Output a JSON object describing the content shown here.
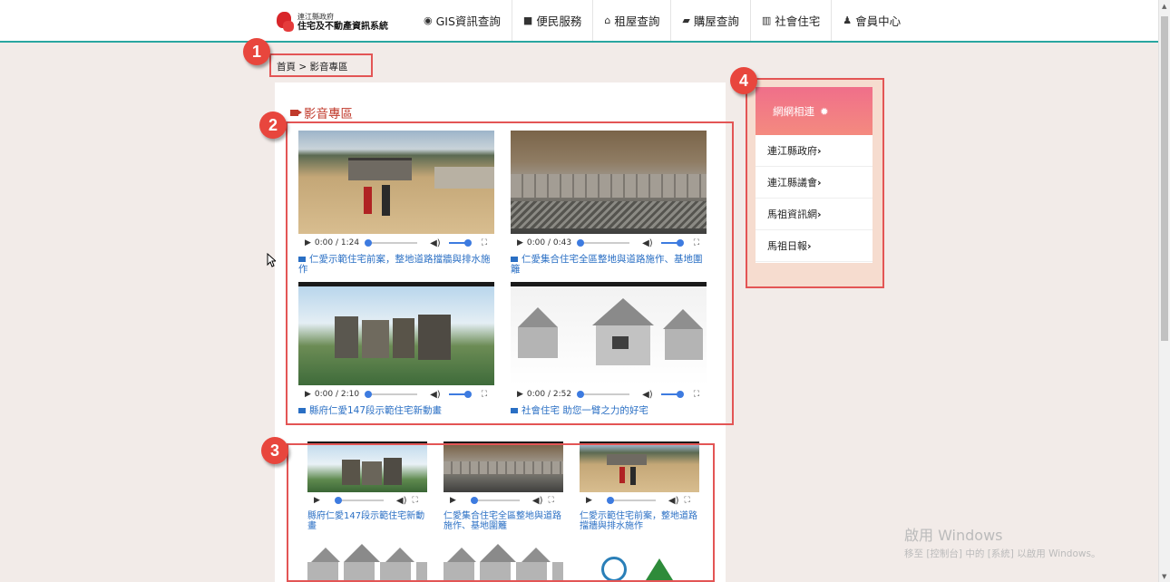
{
  "header": {
    "logo_small": "連江縣政府",
    "logo_big": "住宅及不動產資訊系統",
    "nav": [
      {
        "icon": "globe-icon",
        "glyph": "◉",
        "label": "GIS資訊查詢"
      },
      {
        "icon": "briefcase-icon",
        "glyph": "■",
        "label": "便民服務"
      },
      {
        "icon": "home-icon",
        "glyph": "⌂",
        "label": "租屋查詢"
      },
      {
        "icon": "book-icon",
        "glyph": "▰",
        "label": "購屋查詢"
      },
      {
        "icon": "building-icon",
        "glyph": "▥",
        "label": "社會住宅"
      },
      {
        "icon": "user-icon",
        "glyph": "♟",
        "label": "會員中心"
      }
    ]
  },
  "callouts": [
    "1",
    "2",
    "3",
    "4"
  ],
  "breadcrumb": {
    "home": "首頁",
    "sep": ">",
    "current": "影音專區"
  },
  "section_title": "影音專區",
  "videos": [
    {
      "time": "0:00 / 1:24",
      "caption": "仁愛示範住宅前案，整地道路擋牆與排水施作"
    },
    {
      "time": "0:00 / 0:43",
      "caption": "仁愛集合住宅全區整地與道路施作、基地圍籬"
    },
    {
      "time": "0:00 / 2:10",
      "caption": "縣府仁愛147段示範住宅新動畫"
    },
    {
      "time": "0:00 / 2:52",
      "caption": "社會住宅 助您一臂之力的好宅"
    }
  ],
  "small_videos": [
    {
      "caption": "縣府仁愛147段示範住宅新動畫"
    },
    {
      "caption": "仁愛集合住宅全區整地與道路施作、基地圍籬"
    },
    {
      "caption": "仁愛示範住宅前案，整地道路擋牆與排水施作"
    }
  ],
  "sidebar": {
    "title": "網網相連",
    "links": [
      "連江縣政府",
      "連江縣議會",
      "馬祖資訊網",
      "馬祖日報"
    ]
  },
  "watermark": {
    "line1": "啟用 Windows",
    "line2": "移至 [控制台] 中的 [系統] 以啟用 Windows。"
  },
  "colors": {
    "accent": "#2aa6a0",
    "callout": "#e8463d",
    "link": "#2a6fc4",
    "title": "#c0392b"
  }
}
